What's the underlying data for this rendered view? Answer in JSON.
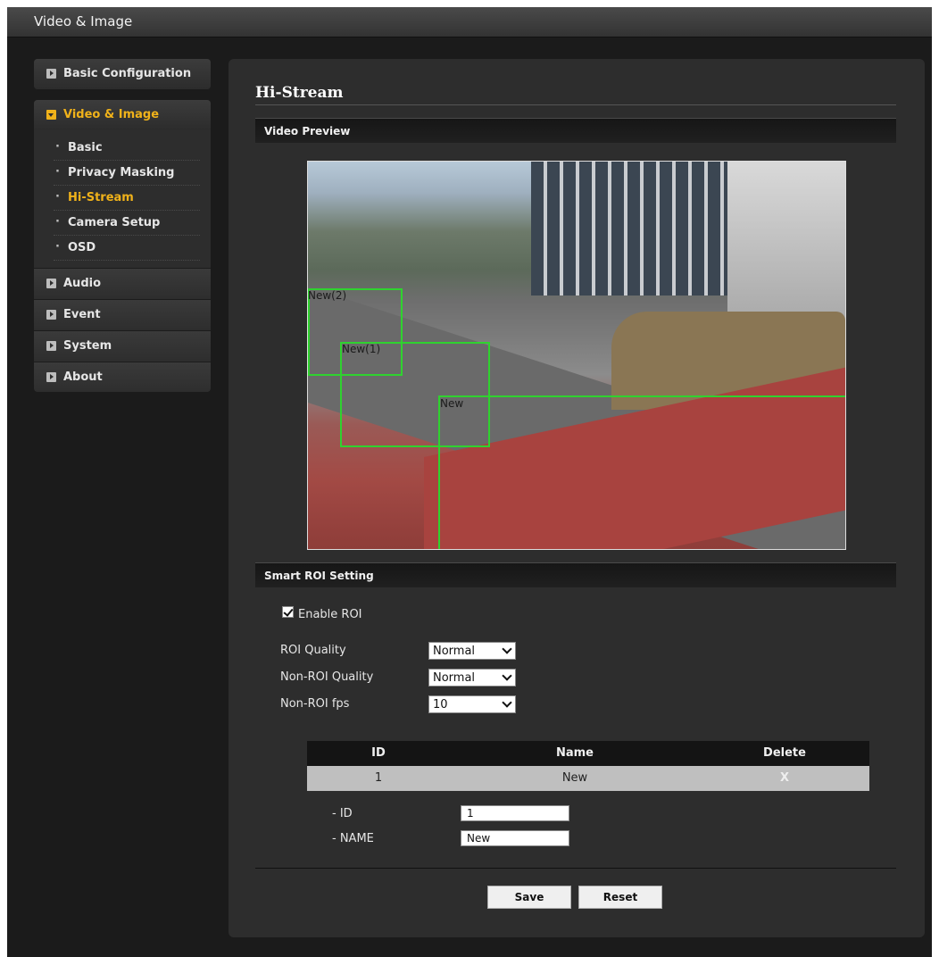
{
  "window": {
    "title": "Video & Image"
  },
  "sidebar": {
    "basic_config": "Basic Configuration",
    "video_image": "Video & Image",
    "sub_items": [
      {
        "label": "Basic"
      },
      {
        "label": "Privacy Masking"
      },
      {
        "label": "Hi-Stream"
      },
      {
        "label": "Camera Setup"
      },
      {
        "label": "OSD"
      }
    ],
    "active_sub": "Hi-Stream",
    "sections": [
      {
        "label": "Audio"
      },
      {
        "label": "Event"
      },
      {
        "label": "System"
      },
      {
        "label": "About"
      }
    ]
  },
  "main": {
    "title": "Hi-Stream",
    "video_preview": {
      "header": "Video Preview",
      "roi_labels": [
        "New(2)",
        "New(1)",
        "New"
      ]
    },
    "smart_roi": {
      "header": "Smart ROI Setting",
      "enable_label": "Enable ROI",
      "enable_checked": true,
      "roi_quality_label": "ROI Quality",
      "roi_quality_value": "Normal",
      "non_roi_quality_label": "Non-ROI Quality",
      "non_roi_quality_value": "Normal",
      "non_roi_fps_label": "Non-ROI fps",
      "non_roi_fps_value": "10"
    },
    "table": {
      "columns": [
        "ID",
        "Name",
        "Delete"
      ],
      "rows": [
        {
          "id": "1",
          "name": "New",
          "delete": "X"
        }
      ]
    },
    "detail": {
      "id_label": "- ID",
      "id_value": "1",
      "name_label": "- NAME",
      "name_value": "New"
    },
    "buttons": {
      "save": "Save",
      "reset": "Reset"
    }
  },
  "colors": {
    "accent": "#f0b21a",
    "roi_box": "#2fd22f",
    "panel": "#2d2d2d"
  }
}
